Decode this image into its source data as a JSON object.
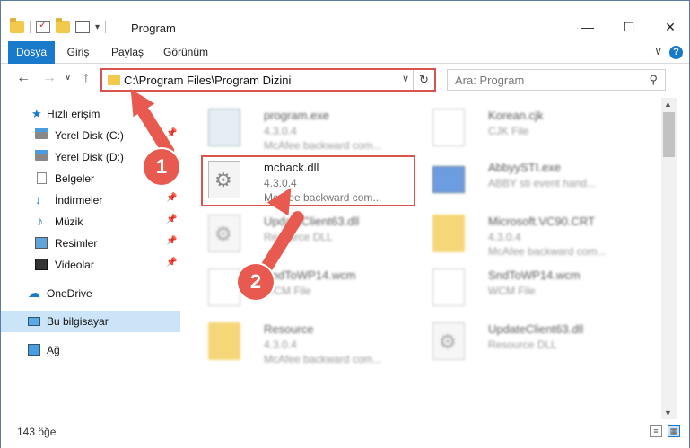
{
  "window": {
    "title": "Program",
    "qat_icons": [
      "folder-icon",
      "properties-icon",
      "folder-icon",
      "customize-icon"
    ],
    "minimize_label": "—",
    "maximize_label": "☐",
    "close_label": "✕"
  },
  "ribbon": {
    "tabs": [
      {
        "label": "Dosya",
        "active": true
      },
      {
        "label": "Giriş",
        "active": false
      },
      {
        "label": "Paylaş",
        "active": false
      },
      {
        "label": "Görünüm",
        "active": false
      }
    ],
    "help_label": "?",
    "collapse_label": "∨",
    "accent": "#1979ca"
  },
  "nav": {
    "back_label": "←",
    "forward_label": "→",
    "recent_label": "∨",
    "up_label": "↑",
    "address_path": "C:\\Program Files\\Program Dizini",
    "dropdown_label": "∨",
    "refresh_label": "↻",
    "search_placeholder": "Ara: Program",
    "search_icon_label": "⚲"
  },
  "sidebar": {
    "items": [
      {
        "label": "Hızlı erişim",
        "icon": "star-icon",
        "pinned": false
      },
      {
        "label": "Yerel Disk (C:)",
        "icon": "disk-icon",
        "pinned": true
      },
      {
        "label": "Yerel Disk (D:)",
        "icon": "disk-icon",
        "pinned": false
      },
      {
        "label": "Belgeler",
        "icon": "documents-icon",
        "pinned": true
      },
      {
        "label": "İndirmeler",
        "icon": "downloads-icon",
        "pinned": true
      },
      {
        "label": "Müzik",
        "icon": "music-icon",
        "pinned": true
      },
      {
        "label": "Resimler",
        "icon": "pictures-icon",
        "pinned": true
      },
      {
        "label": "Videolar",
        "icon": "videos-icon",
        "pinned": true
      },
      {
        "label": "OneDrive",
        "icon": "onedrive-icon",
        "pinned": false
      },
      {
        "label": "Bu bilgisayar",
        "icon": "this-pc-icon",
        "pinned": false,
        "selected": true
      },
      {
        "label": "Ağ",
        "icon": "network-icon",
        "pinned": false
      }
    ],
    "pin_label": "📌"
  },
  "files": [
    {
      "name": "program.exe",
      "line2": "4.3.0.4",
      "line3": "McAfee backward com...",
      "icon": "exe-icon",
      "blurred": true
    },
    {
      "name": "Korean.cjk",
      "line2": "CJK File",
      "line3": "",
      "icon": "page-icon",
      "blurred": true
    },
    {
      "name": "mcback.dll",
      "line2": "4.3.0.4",
      "line3": "McAfee backward com...",
      "icon": "gear-file-icon",
      "blurred": false
    },
    {
      "name": "AbbyySTI.exe",
      "line2": "ABBY sti event hand...",
      "line3": "",
      "icon": "app-icon",
      "blurred": true
    },
    {
      "name": "UpdateClient63.dll",
      "line2": "Resource DLL",
      "line3": "",
      "icon": "gear-file-icon",
      "blurred": true
    },
    {
      "name": "Microsoft.VC90.CRT",
      "line2": "4.3.0.4",
      "line3": "McAfee backward com...",
      "icon": "folder-icon",
      "blurred": true
    },
    {
      "name": "SndToWP14.wcm",
      "line2": "WCM File",
      "line3": "",
      "icon": "page-icon",
      "blurred": true
    },
    {
      "name": "SndToWP14.wcm",
      "line2": "WCM File",
      "line3": "",
      "icon": "page-icon",
      "blurred": true
    },
    {
      "name": "Resource",
      "line2": "4.3.0.4",
      "line3": "McAfee backward com...",
      "icon": "folder-icon",
      "blurred": true
    },
    {
      "name": "UpdateClient63.dll",
      "line2": "Resource DLL",
      "line3": "",
      "icon": "gear-file-icon",
      "blurred": true
    }
  ],
  "status": {
    "item_count": "143 öğe"
  },
  "annotations": {
    "step1": "1",
    "step2": "2",
    "color": "#e85a4f"
  }
}
